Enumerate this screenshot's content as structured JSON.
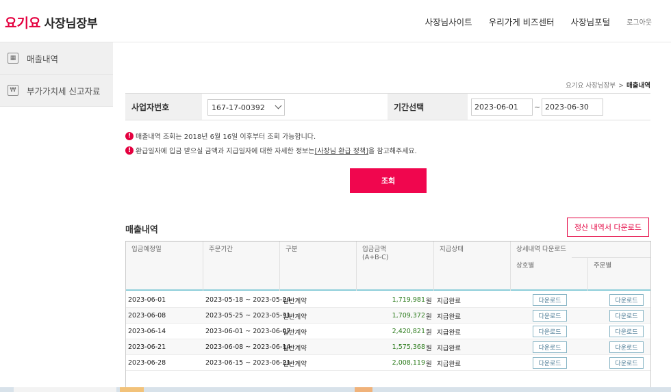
{
  "header": {
    "brand": "요기요",
    "title": "사장님장부",
    "nav": [
      "사장님사이트",
      "우리가게 비즈센터",
      "사장님포털"
    ],
    "logout": "로그아웃"
  },
  "sidebar": {
    "items": [
      {
        "label": "매출내역",
        "icon": "calculator-icon"
      },
      {
        "label": "부가가치세 신고자료",
        "icon": "won-document-icon"
      }
    ]
  },
  "breadcrumb": {
    "parent": "요기요 사장님장부",
    "separator": ">",
    "current": "매출내역"
  },
  "filter": {
    "biz_label": "사업자번호",
    "biz_value": "167-17-00392",
    "period_label": "기간선택",
    "date_from": "2023-06-01",
    "tilde": "~",
    "date_to": "2023-06-30"
  },
  "notices": {
    "n1": "매출내역 조회는 2018년 6월 16일 이후부터 조회 가능합니다.",
    "n2_before": "환급일자에 입금 받으실 금액과 지급일자에 대한 자세한 정보는 ",
    "n2_link": "[사장님 환급 정책]",
    "n2_after": "을 참고해주세요."
  },
  "search_label": "조회",
  "section": {
    "title": "매출내역",
    "download_all": "정산 내역서 다운로드"
  },
  "table": {
    "headers": {
      "deposit_date": "입금예정일",
      "order_period": "주문기간",
      "type": "구분",
      "amount": "입금금액",
      "amount_sub": "(A+B-C)",
      "status": "지급상태",
      "detail": "상세내역 다운로드",
      "by_store": "상호별",
      "by_order": "주문별"
    },
    "download_label": "다운로드",
    "rows": [
      {
        "date": "2023-06-01",
        "period": "2023-05-18 ~ 2023-05-24",
        "type": "일반계약",
        "amount": "1,719,981",
        "unit": "원",
        "status": "지급완료"
      },
      {
        "date": "2023-06-08",
        "period": "2023-05-25 ~ 2023-05-31",
        "type": "일반계약",
        "amount": "1,709,372",
        "unit": "원",
        "status": "지급완료"
      },
      {
        "date": "2023-06-14",
        "period": "2023-06-01 ~ 2023-06-07",
        "type": "일반계약",
        "amount": "2,420,821",
        "unit": "원",
        "status": "지급완료"
      },
      {
        "date": "2023-06-21",
        "period": "2023-06-08 ~ 2023-06-14",
        "type": "일반계약",
        "amount": "1,575,368",
        "unit": "원",
        "status": "지급완료"
      },
      {
        "date": "2023-06-28",
        "period": "2023-06-15 ~ 2023-06-21",
        "type": "일반계약",
        "amount": "2,008,119",
        "unit": "원",
        "status": "지급완료"
      }
    ]
  },
  "colors": {
    "brand": "#e4003f",
    "search_button": "#f0064e",
    "amount": "#2a7a1a"
  }
}
